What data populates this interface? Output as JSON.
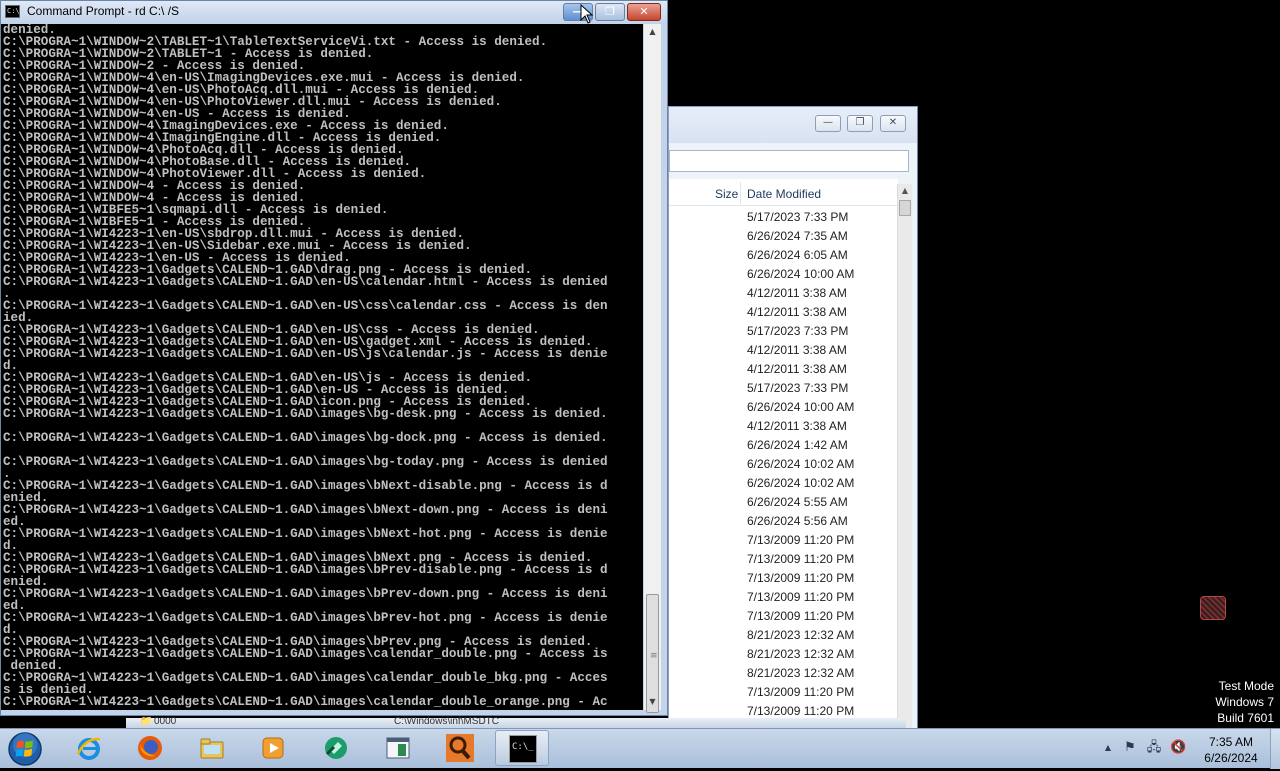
{
  "cmd_window": {
    "title": "Command Prompt - rd  C:\\ /S",
    "icon_label": "C:\\",
    "min_glyph": "—",
    "max_glyph": "❐",
    "close_glyph": "✕",
    "output": "denied.\nC:\\PROGRA~1\\WINDOW~2\\TABLET~1\\TableTextServiceVi.txt - Access is denied.\nC:\\PROGRA~1\\WINDOW~2\\TABLET~1 - Access is denied.\nC:\\PROGRA~1\\WINDOW~2 - Access is denied.\nC:\\PROGRA~1\\WINDOW~4\\en-US\\ImagingDevices.exe.mui - Access is denied.\nC:\\PROGRA~1\\WINDOW~4\\en-US\\PhotoAcq.dll.mui - Access is denied.\nC:\\PROGRA~1\\WINDOW~4\\en-US\\PhotoViewer.dll.mui - Access is denied.\nC:\\PROGRA~1\\WINDOW~4\\en-US - Access is denied.\nC:\\PROGRA~1\\WINDOW~4\\ImagingDevices.exe - Access is denied.\nC:\\PROGRA~1\\WINDOW~4\\ImagingEngine.dll - Access is denied.\nC:\\PROGRA~1\\WINDOW~4\\PhotoAcq.dll - Access is denied.\nC:\\PROGRA~1\\WINDOW~4\\PhotoBase.dll - Access is denied.\nC:\\PROGRA~1\\WINDOW~4\\PhotoViewer.dll - Access is denied.\nC:\\PROGRA~1\\WINDOW~4 - Access is denied.\nC:\\PROGRA~1\\WINDOW~4 - Access is denied.\nC:\\PROGRA~1\\WIBFE5~1\\sqmapi.dll - Access is denied.\nC:\\PROGRA~1\\WIBFE5~1 - Access is denied.\nC:\\PROGRA~1\\WI4223~1\\en-US\\sbdrop.dll.mui - Access is denied.\nC:\\PROGRA~1\\WI4223~1\\en-US\\Sidebar.exe.mui - Access is denied.\nC:\\PROGRA~1\\WI4223~1\\en-US - Access is denied.\nC:\\PROGRA~1\\WI4223~1\\Gadgets\\CALEND~1.GAD\\drag.png - Access is denied.\nC:\\PROGRA~1\\WI4223~1\\Gadgets\\CALEND~1.GAD\\en-US\\calendar.html - Access is denied\n.\nC:\\PROGRA~1\\WI4223~1\\Gadgets\\CALEND~1.GAD\\en-US\\css\\calendar.css - Access is den\nied.\nC:\\PROGRA~1\\WI4223~1\\Gadgets\\CALEND~1.GAD\\en-US\\css - Access is denied.\nC:\\PROGRA~1\\WI4223~1\\Gadgets\\CALEND~1.GAD\\en-US\\gadget.xml - Access is denied.\nC:\\PROGRA~1\\WI4223~1\\Gadgets\\CALEND~1.GAD\\en-US\\js\\calendar.js - Access is denie\nd.\nC:\\PROGRA~1\\WI4223~1\\Gadgets\\CALEND~1.GAD\\en-US\\js - Access is denied.\nC:\\PROGRA~1\\WI4223~1\\Gadgets\\CALEND~1.GAD\\en-US - Access is denied.\nC:\\PROGRA~1\\WI4223~1\\Gadgets\\CALEND~1.GAD\\icon.png - Access is denied.\nC:\\PROGRA~1\\WI4223~1\\Gadgets\\CALEND~1.GAD\\images\\bg-desk.png - Access is denied.\n\nC:\\PROGRA~1\\WI4223~1\\Gadgets\\CALEND~1.GAD\\images\\bg-dock.png - Access is denied.\n\nC:\\PROGRA~1\\WI4223~1\\Gadgets\\CALEND~1.GAD\\images\\bg-today.png - Access is denied\n.\nC:\\PROGRA~1\\WI4223~1\\Gadgets\\CALEND~1.GAD\\images\\bNext-disable.png - Access is d\nenied.\nC:\\PROGRA~1\\WI4223~1\\Gadgets\\CALEND~1.GAD\\images\\bNext-down.png - Access is deni\ned.\nC:\\PROGRA~1\\WI4223~1\\Gadgets\\CALEND~1.GAD\\images\\bNext-hot.png - Access is denie\nd.\nC:\\PROGRA~1\\WI4223~1\\Gadgets\\CALEND~1.GAD\\images\\bNext.png - Access is denied.\nC:\\PROGRA~1\\WI4223~1\\Gadgets\\CALEND~1.GAD\\images\\bPrev-disable.png - Access is d\nenied.\nC:\\PROGRA~1\\WI4223~1\\Gadgets\\CALEND~1.GAD\\images\\bPrev-down.png - Access is deni\ned.\nC:\\PROGRA~1\\WI4223~1\\Gadgets\\CALEND~1.GAD\\images\\bPrev-hot.png - Access is denie\nd.\nC:\\PROGRA~1\\WI4223~1\\Gadgets\\CALEND~1.GAD\\images\\bPrev.png - Access is denied.\nC:\\PROGRA~1\\WI4223~1\\Gadgets\\CALEND~1.GAD\\images\\calendar_double.png - Access is\n denied.\nC:\\PROGRA~1\\WI4223~1\\Gadgets\\CALEND~1.GAD\\images\\calendar_double_bkg.png - Acces\ns is denied.\nC:\\PROGRA~1\\WI4223~1\\Gadgets\\CALEND~1.GAD\\images\\calendar_double_orange.png - Ac",
    "scroll_up": "▲",
    "scroll_down": "▼",
    "scroll_grip": "≡"
  },
  "explorer_window": {
    "min_glyph": "—",
    "max_glyph": "❐",
    "close_glyph": "✕",
    "columns": {
      "size": "Size",
      "date_modified": "Date Modified"
    },
    "scroll_up": "▲",
    "dates": [
      "5/17/2023 7:33 PM",
      "6/26/2024 7:35 AM",
      "6/26/2024 6:05 AM",
      "6/26/2024 10:00 AM",
      "4/12/2011 3:38 AM",
      "4/12/2011 3:38 AM",
      "5/17/2023 7:33 PM",
      "4/12/2011 3:38 AM",
      "4/12/2011 3:38 AM",
      "5/17/2023 7:33 PM",
      "6/26/2024 10:00 AM",
      "4/12/2011 3:38 AM",
      "6/26/2024 1:42 AM",
      "6/26/2024 10:02 AM",
      "6/26/2024 10:02 AM",
      "6/26/2024 5:55 AM",
      "6/26/2024 5:56 AM",
      "7/13/2009 11:20 PM",
      "7/13/2009 11:20 PM",
      "7/13/2009 11:20 PM",
      "7/13/2009 11:20 PM",
      "7/13/2009 11:20 PM",
      "8/21/2023 12:32 AM",
      "8/21/2023 12:32 AM",
      "8/21/2023 12:32 AM",
      "7/13/2009 11:20 PM",
      "7/13/2009 11:20 PM"
    ]
  },
  "watermark": {
    "line1": "Test Mode",
    "line2": "Windows 7",
    "line3": "Build 7601"
  },
  "taskbar": {
    "peek_left": "0000",
    "peek_right": "C:\\Windows\\inf\\MSDTC",
    "cmd_icon_label": "C:\\_",
    "tray_arrow": "▲",
    "flag_glyph": "⚑",
    "network_glyph": "🖧",
    "volume_glyph": "🔇",
    "time": "7:35 AM",
    "date": "6/26/2024"
  },
  "colors": {
    "console_bg": "#000000",
    "console_text": "#c0c0c0",
    "taskbar": "#b7cae2"
  }
}
